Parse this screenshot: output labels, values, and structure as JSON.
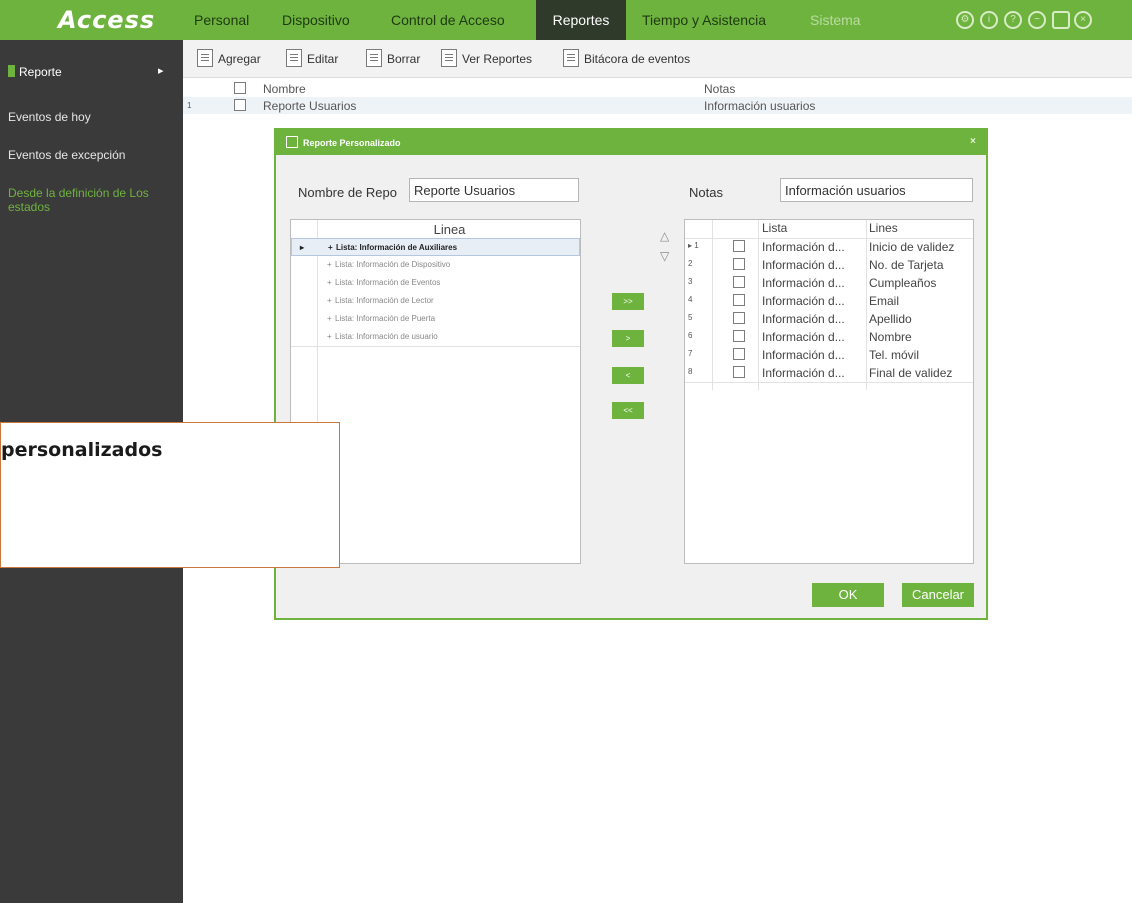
{
  "app": {
    "logo": "Access"
  },
  "nav": {
    "items": [
      "Personal",
      "Dispositivo",
      "Control de Acceso",
      "Reportes",
      "Tiempo y Asistencia",
      "Sistema"
    ],
    "active": "Reportes"
  },
  "topbar_icons": [
    "gear-icon",
    "info-icon",
    "help-icon",
    "minimize-icon",
    "maximize-icon",
    "close-icon"
  ],
  "colors": {
    "accent": "#6fb33f",
    "sidebar": "#3a3a3a",
    "callout_border": "#c9773a"
  },
  "sidebar": {
    "header": "Reporte",
    "items": [
      "Eventos de hoy",
      "Eventos de excepción",
      "Desde la definición de Los estados"
    ]
  },
  "toolbar": {
    "buttons": [
      "Agregar",
      "Editar",
      "Borrar",
      "Ver Reportes",
      "Bitácora de eventos"
    ]
  },
  "grid": {
    "columns": [
      "Nombre",
      "Notas"
    ],
    "rows": [
      {
        "index": "1",
        "nombre": "Reporte Usuarios",
        "notas": "Información usuarios"
      }
    ]
  },
  "dialog": {
    "title": "Reporte Personalizado",
    "name_label": "Nombre de Repo",
    "name_value": "Reporte Usuarios",
    "notes_label": "Notas",
    "notes_value": "Información usuarios",
    "left_list": {
      "header": "Linea",
      "items": [
        "Lista: Información de Auxiliares",
        "Lista: Información de Dispositivo",
        "Lista: Información de Eventos",
        "Lista: Información de Lector",
        "Lista: Información de Puerta",
        "Lista: Información de usuario"
      ],
      "selected": 0
    },
    "move_buttons": [
      ">>",
      ">",
      "<",
      "<<"
    ],
    "right_table": {
      "columns": [
        "Lista",
        "Lines"
      ],
      "rows": [
        {
          "n": "1",
          "lista": "Información d...",
          "linea": "Inicio de validez"
        },
        {
          "n": "2",
          "lista": "Información d...",
          "linea": "No. de Tarjeta"
        },
        {
          "n": "3",
          "lista": "Información d...",
          "linea": "Cumpleaños"
        },
        {
          "n": "4",
          "lista": "Información d...",
          "linea": "Email"
        },
        {
          "n": "5",
          "lista": "Información d...",
          "linea": "Apellido"
        },
        {
          "n": "6",
          "lista": "Información d...",
          "linea": "Nombre"
        },
        {
          "n": "7",
          "lista": "Información d...",
          "linea": "Tel. móvil"
        },
        {
          "n": "8",
          "lista": "Información d...",
          "linea": "Final de validez"
        }
      ]
    },
    "ok_label": "OK",
    "cancel_label": "Cancelar"
  },
  "callout": {
    "text": "personalizados"
  }
}
